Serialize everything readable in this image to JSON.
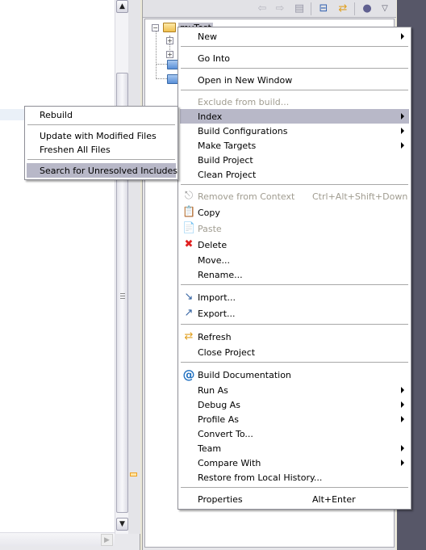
{
  "editor": {
    "hscroll_right_icon": "chevron-right-icon",
    "vscroll_up_icon": "chevron-up-icon",
    "vscroll_down_icon": "chevron-down-icon"
  },
  "toolbar": {
    "icons": [
      "back-arrow-icon",
      "forward-arrow-icon",
      "up-folder-icon",
      "collapse-all-icon",
      "link-with-editor-icon",
      "filter-icon",
      "view-menu-icon"
    ]
  },
  "tree": {
    "project_name": "myTest",
    "children_count": 4
  },
  "context_menu": {
    "items": [
      {
        "label": "New",
        "submenu": true
      },
      {
        "label": "Go Into"
      },
      {
        "label": "Open in New Window"
      },
      {
        "label": "Exclude from build...",
        "disabled": true
      },
      {
        "label": "Index",
        "submenu": true,
        "selected": true
      },
      {
        "label": "Build Configurations",
        "submenu": true
      },
      {
        "label": "Make Targets",
        "submenu": true
      },
      {
        "label": "Build Project"
      },
      {
        "label": "Clean Project"
      },
      {
        "label": "Remove from Context",
        "shortcut": "Ctrl+Alt+Shift+Down",
        "disabled": true,
        "icon": "remove-context-icon"
      },
      {
        "label": "Copy",
        "icon": "copy-icon"
      },
      {
        "label": "Paste",
        "disabled": true,
        "icon": "paste-icon"
      },
      {
        "label": "Delete",
        "icon": "delete-icon"
      },
      {
        "label": "Move..."
      },
      {
        "label": "Rename..."
      },
      {
        "label": "Import...",
        "icon": "import-icon"
      },
      {
        "label": "Export...",
        "icon": "export-icon"
      },
      {
        "label": "Refresh",
        "icon": "refresh-icon"
      },
      {
        "label": "Close Project"
      },
      {
        "label": "Build Documentation",
        "icon": "at-sign-icon"
      },
      {
        "label": "Run As",
        "submenu": true
      },
      {
        "label": "Debug As",
        "submenu": true
      },
      {
        "label": "Profile As",
        "submenu": true
      },
      {
        "label": "Convert To..."
      },
      {
        "label": "Team",
        "submenu": true
      },
      {
        "label": "Compare With",
        "submenu": true
      },
      {
        "label": "Restore from Local History..."
      },
      {
        "label": "Properties",
        "shortcut": "Alt+Enter"
      }
    ]
  },
  "index_submenu": {
    "items": [
      {
        "label": "Rebuild"
      },
      {
        "label": "Update with Modified Files"
      },
      {
        "label": "Freshen All Files"
      },
      {
        "label": "Search for Unresolved Includes",
        "selected": true
      }
    ]
  }
}
